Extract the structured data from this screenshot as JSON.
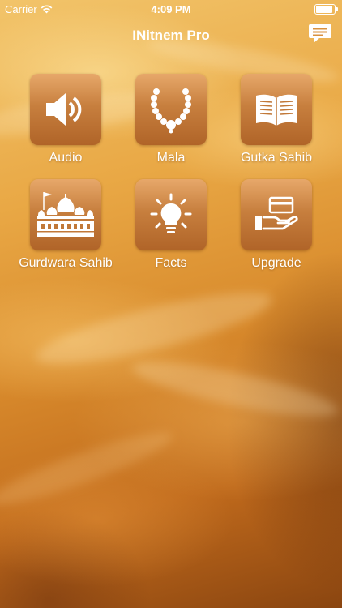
{
  "status_bar": {
    "carrier": "Carrier",
    "time": "4:09 PM"
  },
  "header": {
    "title": "INitnem Pro",
    "chat_icon": "chat-bubble-icon"
  },
  "menu": {
    "items": [
      {
        "label": "Audio",
        "icon": "speaker-icon"
      },
      {
        "label": "Mala",
        "icon": "prayer-beads-icon"
      },
      {
        "label": "Gutka Sahib",
        "icon": "open-book-icon"
      },
      {
        "label": "Gurdwara Sahib",
        "icon": "gurdwara-icon"
      },
      {
        "label": "Facts",
        "icon": "lightbulb-icon"
      },
      {
        "label": "Upgrade",
        "icon": "card-in-hand-icon"
      }
    ]
  },
  "colors": {
    "tile_top": "#e7a86a",
    "tile_bottom": "#b06428",
    "text": "#ffffff"
  }
}
